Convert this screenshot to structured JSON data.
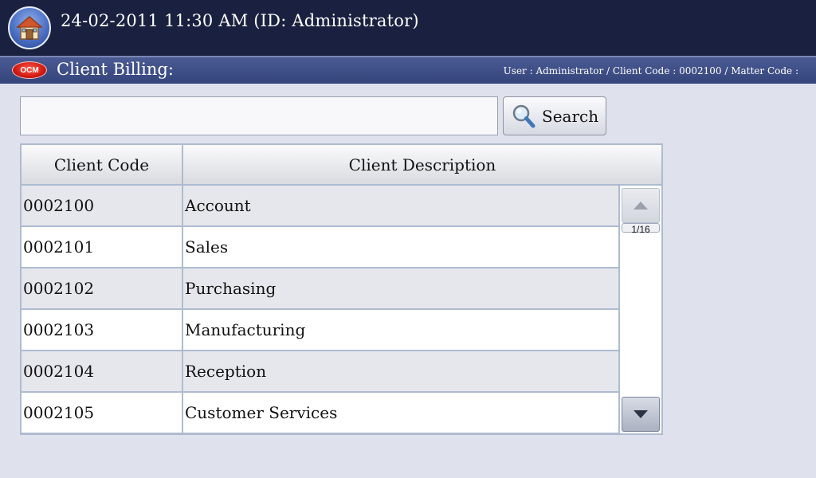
{
  "header": {
    "datetime": "24-02-2011 11:30 AM (ID: Administrator)",
    "home_icon": "home-icon"
  },
  "titlebar": {
    "badge": "OCM",
    "title": "Client Billing:",
    "user_info": "User : Administrator / Client Code : 0002100 / Matter Code :"
  },
  "search": {
    "value": "",
    "button_label": "Search",
    "icon": "magnifier-icon"
  },
  "table": {
    "columns": [
      "Client Code",
      "Client Description"
    ],
    "rows": [
      {
        "code": "0002100",
        "description": "Account"
      },
      {
        "code": "0002101",
        "description": "Sales"
      },
      {
        "code": "0002102",
        "description": "Purchasing"
      },
      {
        "code": "0002103",
        "description": "Manufacturing"
      },
      {
        "code": "0002104",
        "description": "Reception"
      },
      {
        "code": "0002105",
        "description": "Customer Services"
      }
    ]
  },
  "pager": {
    "page_indicator": "1/16",
    "up_icon": "arrow-up-icon",
    "down_icon": "arrow-down-icon"
  },
  "colors": {
    "topbar": "#1a2140",
    "titlebar": "#3d4c86",
    "background": "#dfe1ec",
    "row_alt": "#e6e7ed"
  }
}
